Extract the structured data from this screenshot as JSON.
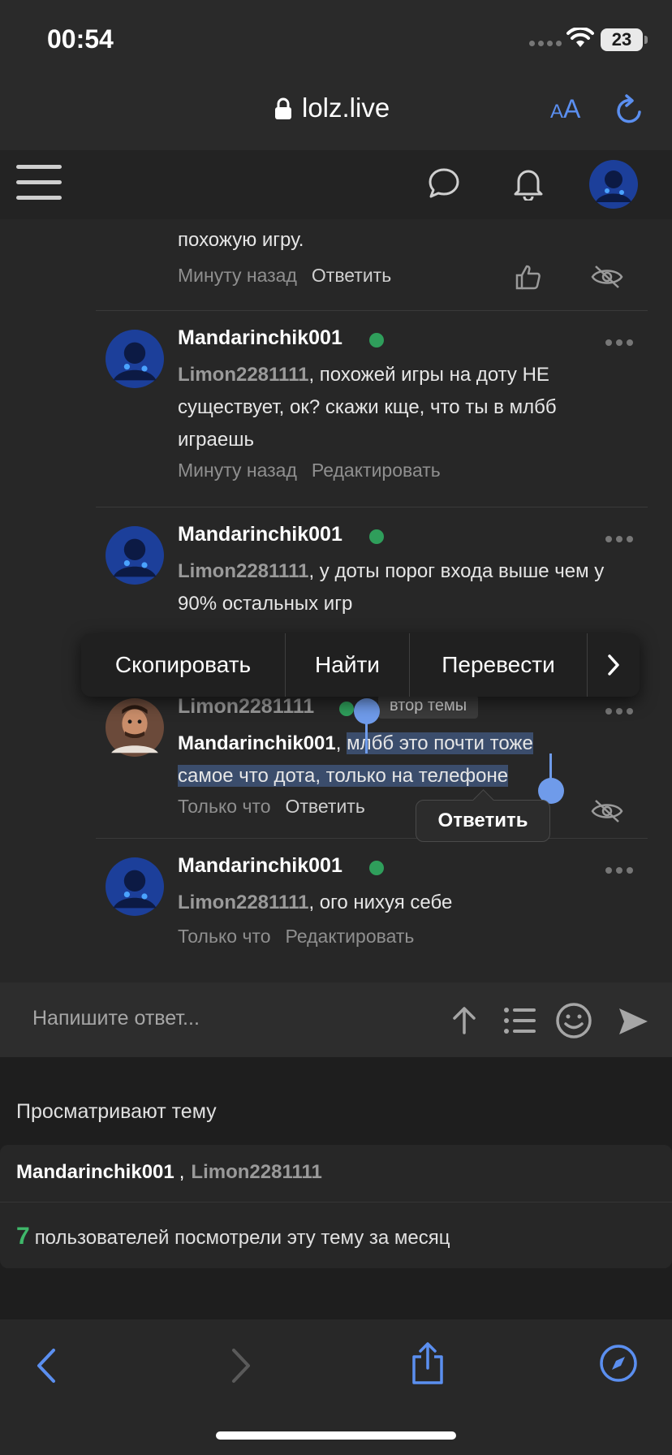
{
  "status_bar": {
    "time": "00:54",
    "battery": "23"
  },
  "browser": {
    "url": "lolz.live",
    "text_size_label_small": "A",
    "text_size_label_large": "A"
  },
  "comments": {
    "tail_text": "похожую игру.",
    "tail_time": "Минуту назад",
    "tail_action": "Ответить",
    "items": [
      {
        "author": "Mandarinchik001",
        "mention": "Limon2281111",
        "text": ", похожей игры на доту НЕ существует, ок? скажи кще, что ты в млбб играешь",
        "time": "Минуту назад",
        "action": "Редактировать"
      },
      {
        "author": "Mandarinchik001",
        "mention": "Limon2281111",
        "text": ", у доты порог входа выше чем у 90% остальных игр"
      },
      {
        "author": "Limon2281111",
        "badge": "втор темы",
        "mention": "Mandarinchik001",
        "text_plain": ", ",
        "text_selected_1": "млбб это почти тоже",
        "text_selected_2": "самое что дота, только на телефоне",
        "time": "Только что",
        "action": "Ответить"
      },
      {
        "author": "Mandarinchik001",
        "mention": "Limon2281111",
        "text": ", ого нихуя себе",
        "time": "Только что",
        "action": "Редактировать"
      }
    ]
  },
  "context_menu": {
    "copy": "Скопировать",
    "find": "Найти",
    "translate": "Перевести"
  },
  "reply_tooltip": "Ответить",
  "composer": {
    "placeholder": "Напишите ответ..."
  },
  "watchers": {
    "title": "Просматривают тему",
    "user1": "Mandarinchik001",
    "separator": ",",
    "user2": "Limon2281111",
    "count": "7",
    "count_text": "пользователей посмотрели эту тему за месяц"
  },
  "colors": {
    "accent": "#5b8ff0",
    "online": "#2f9e5b",
    "count_green": "#3fb86a",
    "selection": "#3b4d6c"
  },
  "icons": [
    "lock-icon",
    "text-size-icon",
    "reload-icon",
    "menu-icon",
    "chat-icon",
    "bell-icon",
    "like-icon",
    "hide-icon",
    "more-icon",
    "upload-icon",
    "list-icon",
    "smile-icon",
    "send-icon",
    "back-icon",
    "forward-icon",
    "share-icon",
    "compass-icon"
  ]
}
